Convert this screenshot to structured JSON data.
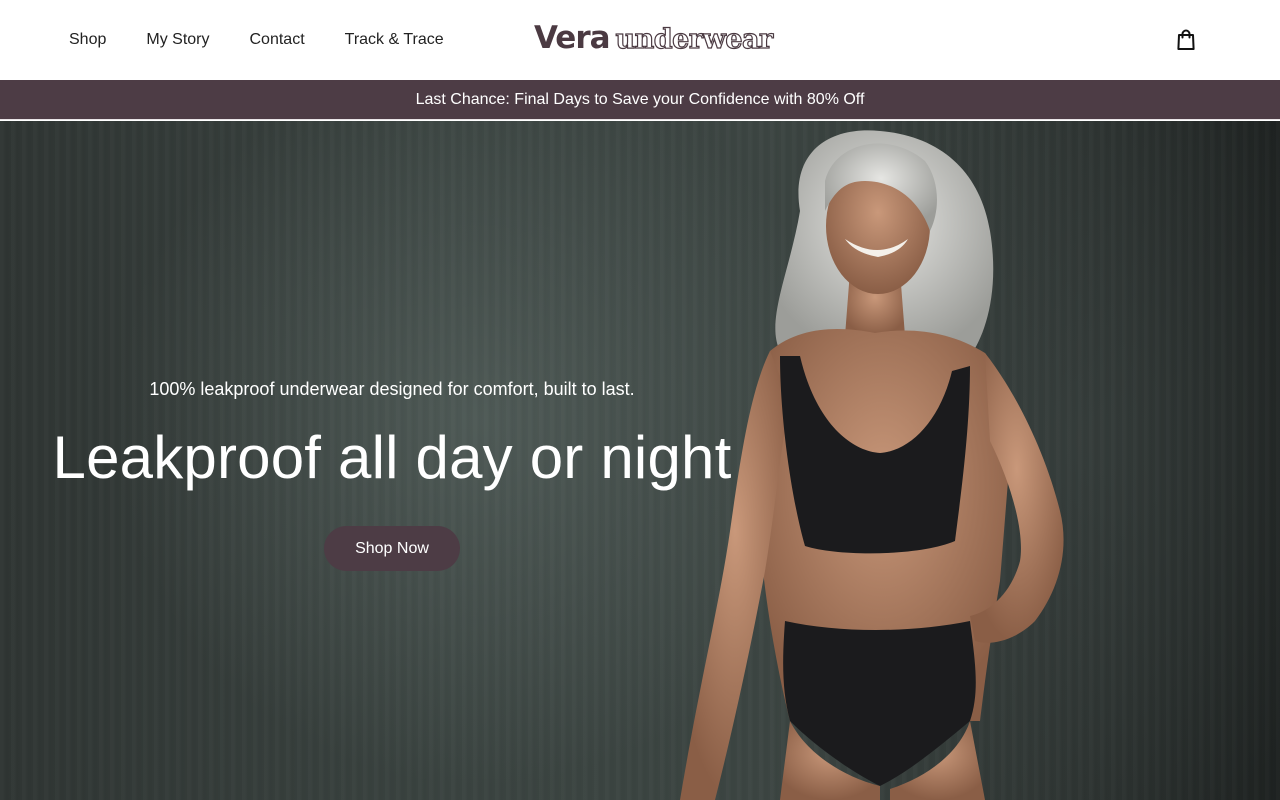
{
  "header": {
    "nav": [
      {
        "label": "Shop"
      },
      {
        "label": "My Story"
      },
      {
        "label": "Contact"
      },
      {
        "label": "Track & Trace"
      }
    ],
    "logo": {
      "primary": "Vera",
      "secondary": "underwear"
    },
    "cart_icon": "shopping-bag-icon"
  },
  "announcement": {
    "text": "Last Chance: Final Days to Save your Confidence with 80% Off"
  },
  "hero": {
    "subtitle": "100% leakproof underwear designed for comfort, built to last.",
    "title": "Leakproof all day or night",
    "cta_label": "Shop Now",
    "image": "woman-in-black-leakproof-underwear-photo"
  },
  "colors": {
    "brand": "#4d3c45",
    "header_bg": "#ffffff",
    "hero_bg": "#3a4340",
    "hero_text": "#ffffff"
  }
}
